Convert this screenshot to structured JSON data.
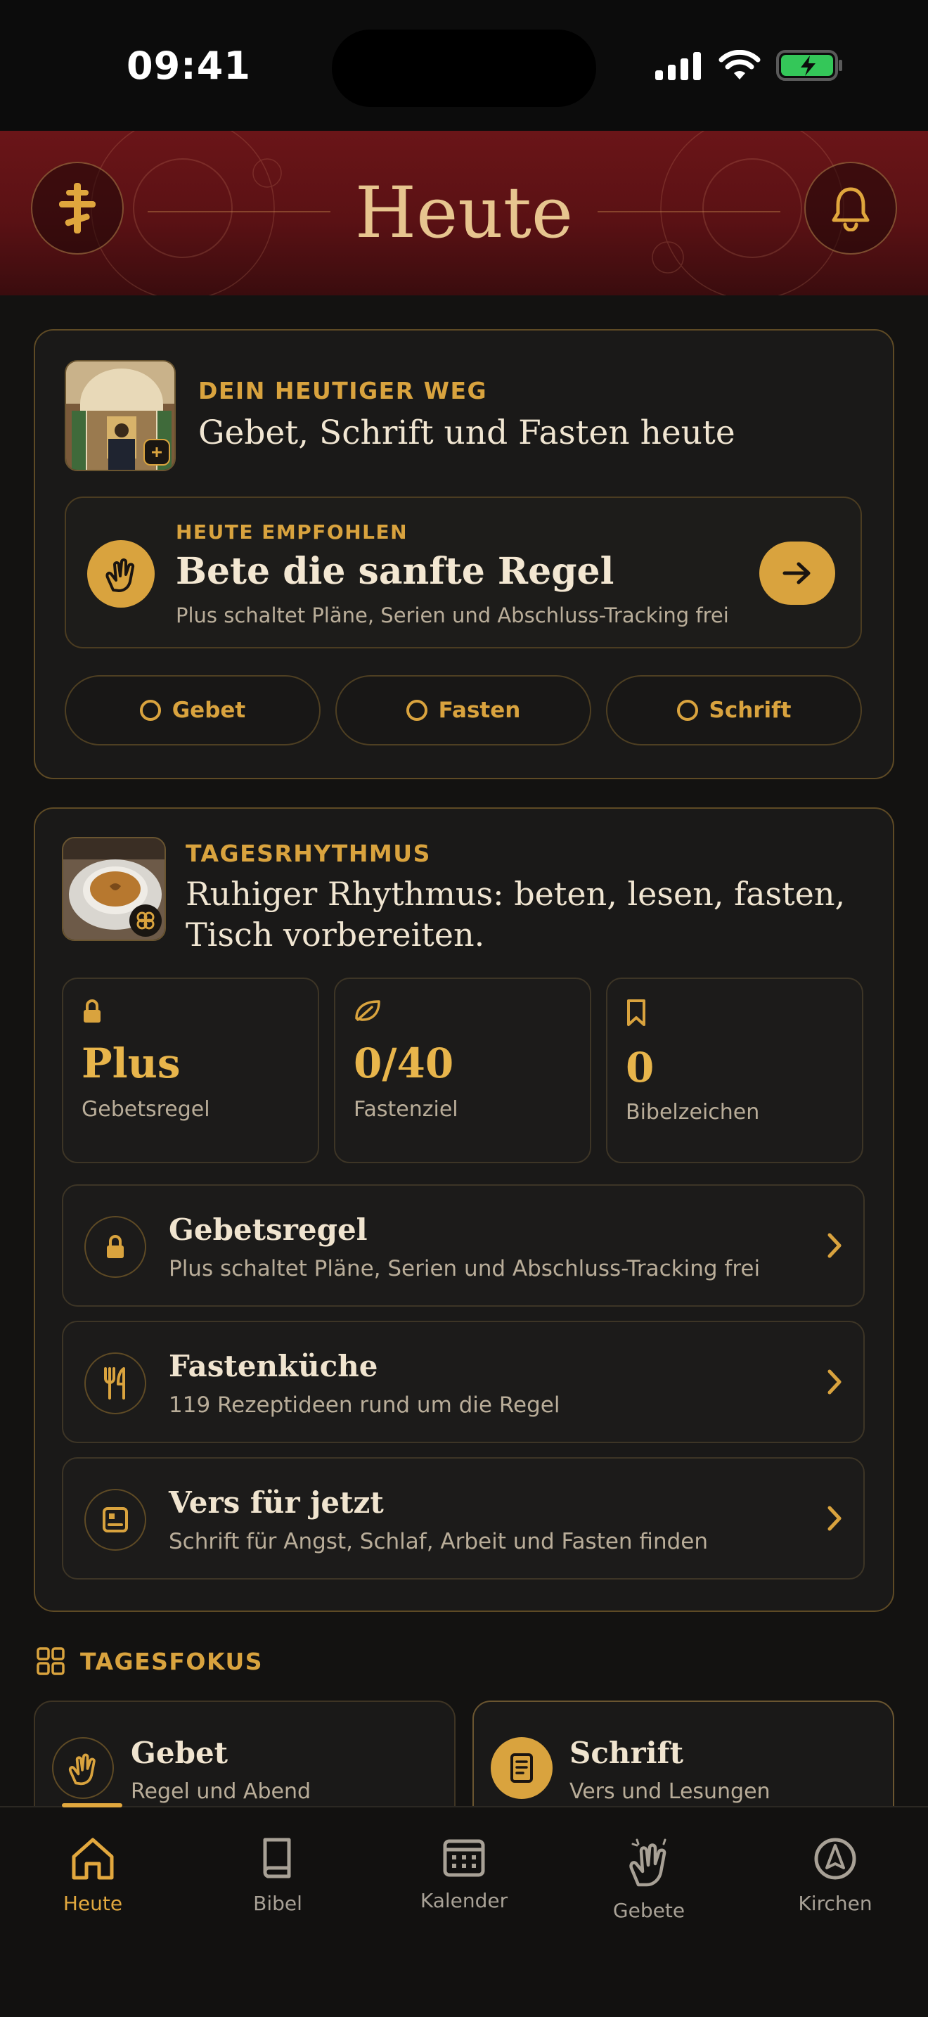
{
  "status_bar": {
    "time": "09:41"
  },
  "header": {
    "title": "Heute"
  },
  "today_card": {
    "eyebrow": "DEIN HEUTIGER WEG",
    "title": "Gebet, Schrift und Fasten heute",
    "recommendation": {
      "eyebrow": "HEUTE EMPFOHLEN",
      "title": "Bete die sanfte Regel",
      "subtitle": "Plus schaltet Pläne, Serien und Abschluss-Tracking frei"
    },
    "pills": [
      {
        "label": "Gebet"
      },
      {
        "label": "Fasten"
      },
      {
        "label": "Schrift"
      }
    ]
  },
  "rhythm_card": {
    "eyebrow": "TAGESRHYTHMUS",
    "title_line1": "Ruhiger Rhythmus: beten, lesen, fasten,",
    "title_line2": "Tisch vorbereiten.",
    "stats": [
      {
        "value": "Plus",
        "label": "Gebetsregel",
        "icon": "lock-icon"
      },
      {
        "value": "0/40",
        "label": "Fastenziel",
        "icon": "leaf-icon"
      },
      {
        "value": "0",
        "label": "Bibelzeichen",
        "icon": "bookmark-icon"
      }
    ],
    "rows": [
      {
        "title": "Gebetsregel",
        "subtitle": "Plus schaltet Pläne, Serien und Abschluss-Tracking frei",
        "icon": "lock-icon"
      },
      {
        "title": "Fastenküche",
        "subtitle": "119 Rezeptideen rund um die Regel",
        "icon": "fork-knife-icon"
      },
      {
        "title": "Vers für jetzt",
        "subtitle": "Schrift für Angst, Schlaf, Arbeit und Fasten finden",
        "icon": "scripture-icon"
      }
    ]
  },
  "focus": {
    "heading": "TAGESFOKUS",
    "cards": [
      {
        "title": "Gebet",
        "subtitle": "Regel und Abend",
        "icon": "praying-hands-icon"
      },
      {
        "title": "Schrift",
        "subtitle": "Vers und Lesungen",
        "icon": "book-icon"
      }
    ]
  },
  "tabbar": {
    "tabs": [
      {
        "label": "Heute",
        "icon": "home-icon",
        "active": true
      },
      {
        "label": "Bibel",
        "icon": "book-icon",
        "active": false
      },
      {
        "label": "Kalender",
        "icon": "calendar-icon",
        "active": false
      },
      {
        "label": "Gebete",
        "icon": "praying-hands-icon",
        "active": false
      },
      {
        "label": "Kirchen",
        "icon": "compass-icon",
        "active": false
      }
    ]
  },
  "colors": {
    "accent": "#d9a33e",
    "header_red": "#5a1114",
    "background": "#131211"
  }
}
